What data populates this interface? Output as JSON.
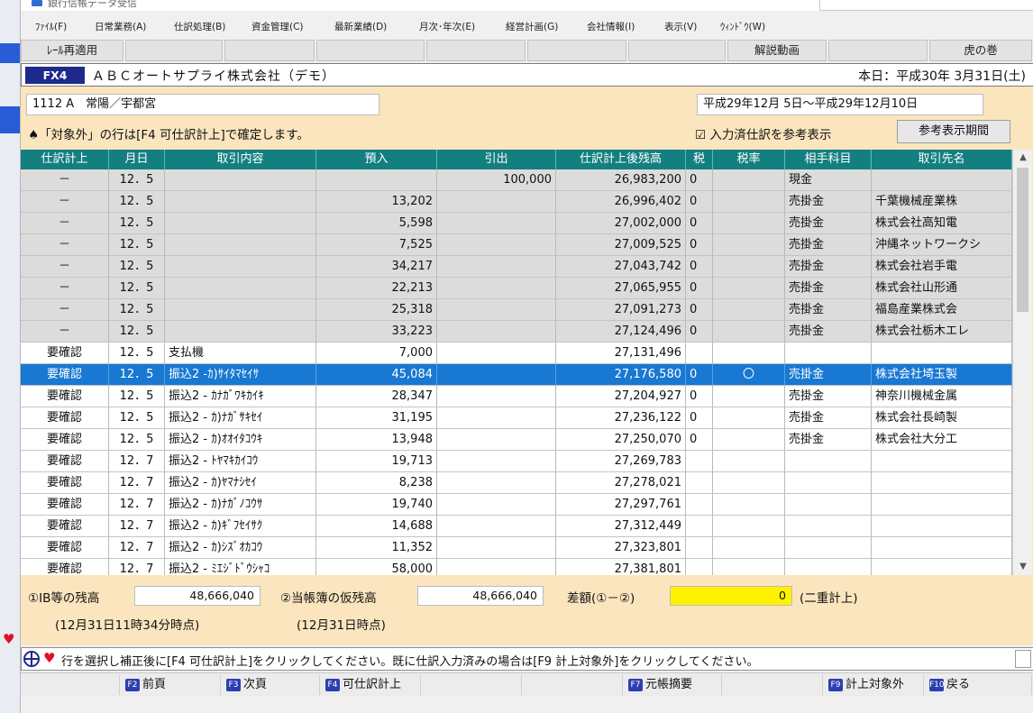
{
  "window": {
    "title": "銀行信帳データ受信"
  },
  "menu": [
    "ﾌｧｲﾙ(F)",
    "日常業務(A)",
    "仕訳処理(B)",
    "資金管理(C)",
    "最新業績(D)",
    "月次･年次(E)",
    "経営計画(G)",
    "会社情報(I)",
    "表示(V)",
    "ｳｨﾝﾄﾞｳ(W)"
  ],
  "fkeys": {
    "f1": "ﾚｰﾙ再適用",
    "video": "解説動画",
    "manual": "虎の巻"
  },
  "header": {
    "code": "FX4",
    "company": "ＡＢＣオートサプライ株式会社（デモ）",
    "today": "本日：平成30年 3月31日(土)"
  },
  "account": "1112 A　常陽／宇都宮",
  "period": "平成29年12月 5日～平成29年12月10日",
  "notice": "♠「対象外」の行は[F4 可仕訳計上]で確定します。",
  "ref_check": "☑ 入力済仕訳を参考表示",
  "ref_button": "参考表示期間",
  "columns": [
    "仕訳計上",
    "月日",
    "取引内容",
    "預入",
    "引出",
    "仕訳計上後残高",
    "税",
    "税率",
    "相手科目",
    "取引先名"
  ],
  "rows": [
    {
      "status": "－",
      "date": "12．5",
      "desc": "",
      "deposit": "",
      "withdraw": "100,000",
      "balance": "26,983,200",
      "tax": "0",
      "rate": "",
      "acct": "現金",
      "partner": ""
    },
    {
      "status": "－",
      "date": "12．5",
      "desc": "",
      "deposit": "13,202",
      "withdraw": "",
      "balance": "26,996,402",
      "tax": "0",
      "rate": "",
      "acct": "売掛金",
      "partner": "千葉機械産業株"
    },
    {
      "status": "－",
      "date": "12．5",
      "desc": "",
      "deposit": "5,598",
      "withdraw": "",
      "balance": "27,002,000",
      "tax": "0",
      "rate": "",
      "acct": "売掛金",
      "partner": "株式会社高知電"
    },
    {
      "status": "－",
      "date": "12．5",
      "desc": "",
      "deposit": "7,525",
      "withdraw": "",
      "balance": "27,009,525",
      "tax": "0",
      "rate": "",
      "acct": "売掛金",
      "partner": "沖縄ネットワークシ"
    },
    {
      "status": "－",
      "date": "12．5",
      "desc": "",
      "deposit": "34,217",
      "withdraw": "",
      "balance": "27,043,742",
      "tax": "0",
      "rate": "",
      "acct": "売掛金",
      "partner": "株式会社岩手電"
    },
    {
      "status": "－",
      "date": "12．5",
      "desc": "",
      "deposit": "22,213",
      "withdraw": "",
      "balance": "27,065,955",
      "tax": "0",
      "rate": "",
      "acct": "売掛金",
      "partner": "株式会社山形通"
    },
    {
      "status": "－",
      "date": "12．5",
      "desc": "",
      "deposit": "25,318",
      "withdraw": "",
      "balance": "27,091,273",
      "tax": "0",
      "rate": "",
      "acct": "売掛金",
      "partner": "福島産業株式会"
    },
    {
      "status": "－",
      "date": "12．5",
      "desc": "",
      "deposit": "33,223",
      "withdraw": "",
      "balance": "27,124,496",
      "tax": "0",
      "rate": "",
      "acct": "売掛金",
      "partner": "株式会社栃木エレ"
    },
    {
      "status": "要確認",
      "date": "12．5",
      "desc": "支払機",
      "deposit": "7,000",
      "withdraw": "",
      "balance": "27,131,496",
      "tax": "",
      "rate": "",
      "acct": "",
      "partner": ""
    },
    {
      "status": "要確認",
      "date": "12．5",
      "desc": "振込2 -ｶ)ｻｲﾀﾏｾｲｻ",
      "deposit": "45,084",
      "withdraw": "",
      "balance": "27,176,580",
      "tax": "0",
      "rate": "〇",
      "acct": "売掛金",
      "partner": "株式会社埼玉製"
    },
    {
      "status": "要確認",
      "date": "12．5",
      "desc": "振込2 - ｶﾅｶﾞﾜｷｶｲｷ",
      "deposit": "28,347",
      "withdraw": "",
      "balance": "27,204,927",
      "tax": "0",
      "rate": "",
      "acct": "売掛金",
      "partner": "神奈川機械金属"
    },
    {
      "status": "要確認",
      "date": "12．5",
      "desc": "振込2 - ｶ)ﾅｶﾞｻｷｾｲ",
      "deposit": "31,195",
      "withdraw": "",
      "balance": "27,236,122",
      "tax": "0",
      "rate": "",
      "acct": "売掛金",
      "partner": "株式会社長崎製"
    },
    {
      "status": "要確認",
      "date": "12．5",
      "desc": "振込2 - ｶ)ｵｵｲﾀｺｳｷ",
      "deposit": "13,948",
      "withdraw": "",
      "balance": "27,250,070",
      "tax": "0",
      "rate": "",
      "acct": "売掛金",
      "partner": "株式会社大分工"
    },
    {
      "status": "要確認",
      "date": "12．7",
      "desc": "振込2 - ﾄﾔﾏｷｶｲｺｳ",
      "deposit": "19,713",
      "withdraw": "",
      "balance": "27,269,783",
      "tax": "",
      "rate": "",
      "acct": "",
      "partner": ""
    },
    {
      "status": "要確認",
      "date": "12．7",
      "desc": "振込2 - ｶ)ﾔﾏﾅｼｾｲ",
      "deposit": "8,238",
      "withdraw": "",
      "balance": "27,278,021",
      "tax": "",
      "rate": "",
      "acct": "",
      "partner": ""
    },
    {
      "status": "要確認",
      "date": "12．7",
      "desc": "振込2 - ｶ)ﾅｶﾞﾉｺｳｻ",
      "deposit": "19,740",
      "withdraw": "",
      "balance": "27,297,761",
      "tax": "",
      "rate": "",
      "acct": "",
      "partner": ""
    },
    {
      "status": "要確認",
      "date": "12．7",
      "desc": "振込2 - ｶ)ｷﾞﾌｾｲｻｸ",
      "deposit": "14,688",
      "withdraw": "",
      "balance": "27,312,449",
      "tax": "",
      "rate": "",
      "acct": "",
      "partner": ""
    },
    {
      "status": "要確認",
      "date": "12．7",
      "desc": "振込2 - ｶ)ｼｽﾞｵｶｺｳ",
      "deposit": "11,352",
      "withdraw": "",
      "balance": "27,323,801",
      "tax": "",
      "rate": "",
      "acct": "",
      "partner": ""
    },
    {
      "status": "要確認",
      "date": "12．7",
      "desc": "振込2 - ﾐｴｼﾞﾄﾞｳｼｬｺ",
      "deposit": "58,000",
      "withdraw": "",
      "balance": "27,381,801",
      "tax": "",
      "rate": "",
      "acct": "",
      "partner": ""
    }
  ],
  "selected_row": 9,
  "summary": {
    "bank_label": "①IB等の残高",
    "bank_value": "48,666,040",
    "bank_time": "(12月31日11時34分時点)",
    "book_label": "②当帳簿の仮残高",
    "book_value": "48,666,040",
    "book_time": "(12月31日時点)",
    "diff_label": "差額(①－②)",
    "diff_value": "0",
    "diff_note": "(二重計上)"
  },
  "hint": "行を選択し補正後に[F4 可仕訳計上]をクリックしてください。既に仕訳入力済みの場合は[F9 計上対象外]をクリックしてください。",
  "bottom_keys": [
    {
      "key": "F2",
      "label": "前頁"
    },
    {
      "key": "F3",
      "label": "次頁"
    },
    {
      "key": "F4",
      "label": "可仕訳計上"
    },
    {
      "key": "F7",
      "label": "元帳摘要"
    },
    {
      "key": "F9",
      "label": "計上対象外"
    },
    {
      "key": "F10",
      "label": "戻る"
    }
  ]
}
